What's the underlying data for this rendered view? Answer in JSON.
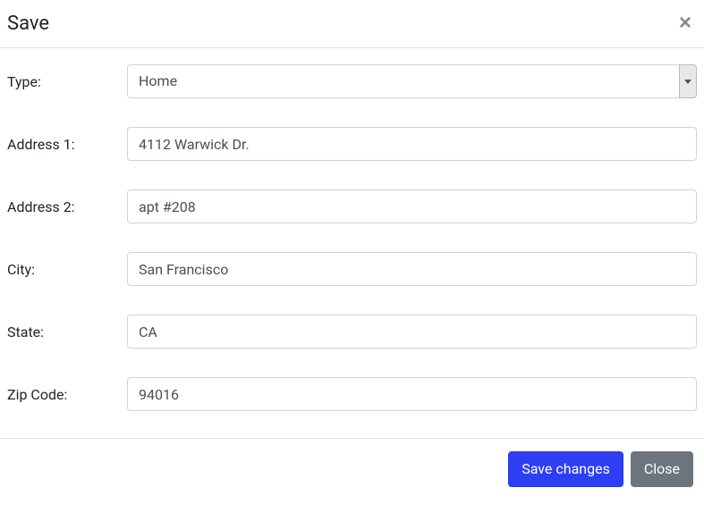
{
  "modal": {
    "title": "Save",
    "close_glyph": "×"
  },
  "form": {
    "type": {
      "label": "Type:",
      "value": "Home"
    },
    "address1": {
      "label": "Address 1:",
      "value": "4112 Warwick Dr."
    },
    "address2": {
      "label": "Address 2:",
      "value": "apt #208"
    },
    "city": {
      "label": "City:",
      "value": "San Francisco"
    },
    "state": {
      "label": "State:",
      "value": "CA"
    },
    "zip": {
      "label": "Zip Code:",
      "value": "94016"
    }
  },
  "footer": {
    "save_label": "Save changes",
    "close_label": "Close"
  }
}
